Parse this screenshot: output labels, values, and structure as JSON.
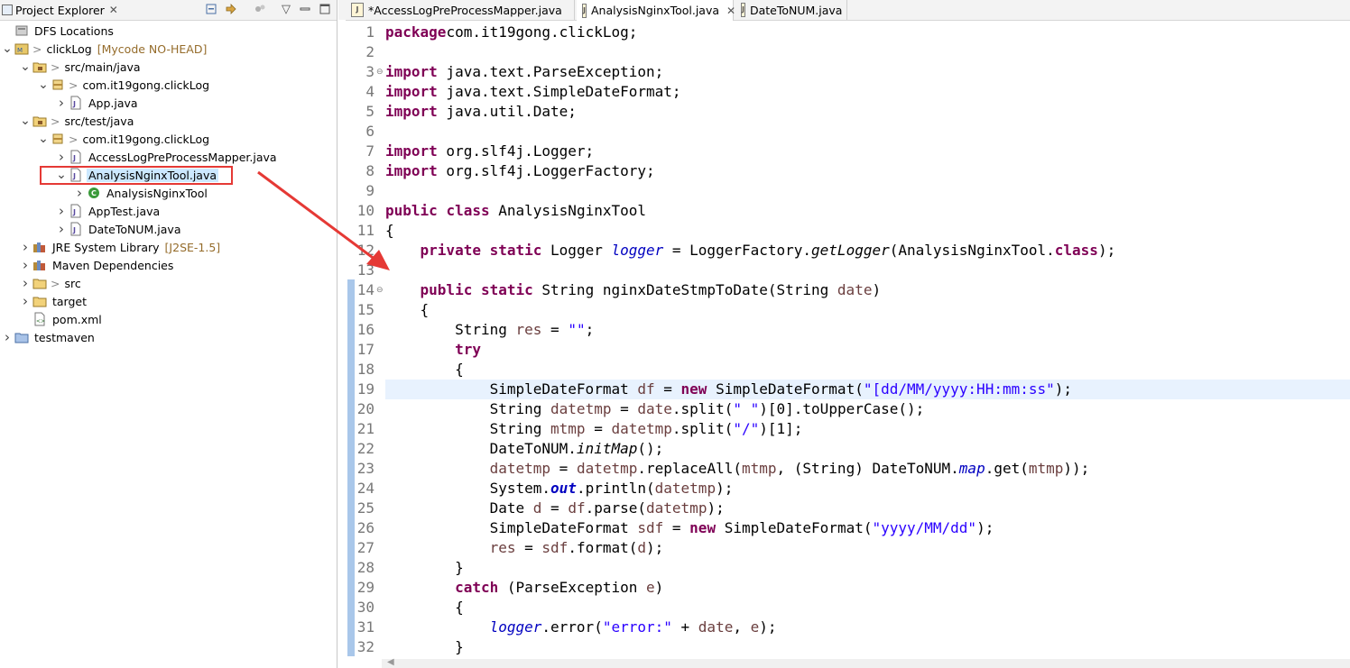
{
  "explorer": {
    "title": "Project Explorer",
    "tree": [
      {
        "indent": 0,
        "twisty": "",
        "icon": "dfs",
        "label": "DFS Locations"
      },
      {
        "indent": 0,
        "twisty": "v",
        "icon": "project",
        "label": "clickLog",
        "prefix": ">",
        "decoration": "[Mycode NO-HEAD]"
      },
      {
        "indent": 1,
        "twisty": "v",
        "icon": "srcfolder",
        "label": "src/main/java",
        "prefix": ">"
      },
      {
        "indent": 2,
        "twisty": "v",
        "icon": "package",
        "label": "com.it19gong.clickLog",
        "prefix": ">"
      },
      {
        "indent": 3,
        "twisty": ">",
        "icon": "java",
        "label": "App.java"
      },
      {
        "indent": 1,
        "twisty": "v",
        "icon": "srcfolder",
        "label": "src/test/java",
        "prefix": ">"
      },
      {
        "indent": 2,
        "twisty": "v",
        "icon": "package",
        "label": "com.it19gong.clickLog",
        "prefix": ">"
      },
      {
        "indent": 3,
        "twisty": ">",
        "icon": "java",
        "label": "AccessLogPreProcessMapper.java"
      },
      {
        "indent": 3,
        "twisty": "v",
        "icon": "java",
        "label": "AnalysisNginxTool.java",
        "selected": true
      },
      {
        "indent": 4,
        "twisty": ">",
        "icon": "class",
        "label": "AnalysisNginxTool"
      },
      {
        "indent": 3,
        "twisty": ">",
        "icon": "java",
        "label": "AppTest.java"
      },
      {
        "indent": 3,
        "twisty": ">",
        "icon": "java",
        "label": "DateToNUM.java"
      },
      {
        "indent": 1,
        "twisty": ">",
        "icon": "library",
        "label": "JRE System Library",
        "decoration": "[J2SE-1.5]"
      },
      {
        "indent": 1,
        "twisty": ">",
        "icon": "library",
        "label": "Maven Dependencies"
      },
      {
        "indent": 1,
        "twisty": ">",
        "icon": "folder",
        "label": "src",
        "prefix": ">"
      },
      {
        "indent": 1,
        "twisty": ">",
        "icon": "folder",
        "label": "target"
      },
      {
        "indent": 1,
        "twisty": "",
        "icon": "xml",
        "label": "pom.xml"
      },
      {
        "indent": 0,
        "twisty": ">",
        "icon": "project2",
        "label": "testmaven"
      }
    ]
  },
  "editor": {
    "tabs": [
      {
        "label": "*AccessLogPreProcessMapper.java",
        "active": false
      },
      {
        "label": "AnalysisNginxTool.java",
        "active": true
      },
      {
        "label": "DateToNUM.java",
        "active": false
      }
    ],
    "current_line": 19,
    "lines": [
      {
        "n": 1,
        "t": [
          [
            "kw",
            "package"
          ],
          [
            "",
            "com.it19gong.clickLog;"
          ]
        ]
      },
      {
        "n": 2,
        "t": []
      },
      {
        "n": 3,
        "fold": true,
        "t": [
          [
            "kw",
            "import"
          ],
          [
            "",
            " java.text.ParseException;"
          ]
        ]
      },
      {
        "n": 4,
        "t": [
          [
            "kw",
            "import"
          ],
          [
            "",
            " java.text.SimpleDateFormat;"
          ]
        ]
      },
      {
        "n": 5,
        "t": [
          [
            "kw",
            "import"
          ],
          [
            "",
            " java.util.Date;"
          ]
        ]
      },
      {
        "n": 6,
        "t": []
      },
      {
        "n": 7,
        "t": [
          [
            "kw",
            "import"
          ],
          [
            "",
            " org.slf4j.Logger;"
          ]
        ]
      },
      {
        "n": 8,
        "t": [
          [
            "kw",
            "import"
          ],
          [
            "",
            " org.slf4j.LoggerFactory;"
          ]
        ]
      },
      {
        "n": 9,
        "t": []
      },
      {
        "n": 10,
        "t": [
          [
            "kw",
            "public"
          ],
          [
            "",
            " "
          ],
          [
            "kw",
            "class"
          ],
          [
            "",
            " AnalysisNginxTool"
          ]
        ]
      },
      {
        "n": 11,
        "t": [
          [
            "",
            "{"
          ]
        ]
      },
      {
        "n": 12,
        "t": [
          [
            "",
            "    "
          ],
          [
            "kw",
            "private"
          ],
          [
            "",
            " "
          ],
          [
            "kw",
            "static"
          ],
          [
            "",
            " Logger "
          ],
          [
            "fld",
            "logger"
          ],
          [
            "",
            " = LoggerFactory."
          ],
          [
            "ital",
            "getLogger"
          ],
          [
            "",
            "(AnalysisNginxTool."
          ],
          [
            "kw",
            "class"
          ],
          [
            "",
            ");"
          ]
        ]
      },
      {
        "n": 13,
        "t": []
      },
      {
        "n": 14,
        "fold": true,
        "t": [
          [
            "",
            "    "
          ],
          [
            "kw",
            "public"
          ],
          [
            "",
            " "
          ],
          [
            "kw",
            "static"
          ],
          [
            "",
            " String nginxDateStmpToDate(String "
          ],
          [
            "var",
            "date"
          ],
          [
            "",
            ")"
          ]
        ]
      },
      {
        "n": 15,
        "t": [
          [
            "",
            "    {"
          ]
        ]
      },
      {
        "n": 16,
        "t": [
          [
            "",
            "        String "
          ],
          [
            "var",
            "res"
          ],
          [
            "",
            " = "
          ],
          [
            "str",
            "\"\""
          ],
          [
            "",
            ";"
          ]
        ]
      },
      {
        "n": 17,
        "t": [
          [
            "",
            "        "
          ],
          [
            "kw",
            "try"
          ]
        ]
      },
      {
        "n": 18,
        "t": [
          [
            "",
            "        {"
          ]
        ]
      },
      {
        "n": 19,
        "t": [
          [
            "",
            "            SimpleDateFormat "
          ],
          [
            "var",
            "df"
          ],
          [
            "",
            " = "
          ],
          [
            "kw",
            "new"
          ],
          [
            "",
            " SimpleDateFormat("
          ],
          [
            "str",
            "\"[dd/MM/yyyy:HH:mm:ss\""
          ],
          [
            "",
            ");"
          ]
        ]
      },
      {
        "n": 20,
        "t": [
          [
            "",
            "            String "
          ],
          [
            "var",
            "datetmp"
          ],
          [
            "",
            " = "
          ],
          [
            "var",
            "date"
          ],
          [
            "",
            ".split("
          ],
          [
            "str",
            "\" \""
          ],
          [
            "",
            ")[0].toUpperCase();"
          ]
        ]
      },
      {
        "n": 21,
        "t": [
          [
            "",
            "            String "
          ],
          [
            "var",
            "mtmp"
          ],
          [
            "",
            " = "
          ],
          [
            "var",
            "datetmp"
          ],
          [
            "",
            ".split("
          ],
          [
            "str",
            "\"/\""
          ],
          [
            "",
            ")[1];"
          ]
        ]
      },
      {
        "n": 22,
        "t": [
          [
            "",
            "            DateToNUM."
          ],
          [
            "ital",
            "initMap"
          ],
          [
            "",
            "();"
          ]
        ]
      },
      {
        "n": 23,
        "t": [
          [
            "",
            "            "
          ],
          [
            "var",
            "datetmp"
          ],
          [
            "",
            " = "
          ],
          [
            "var",
            "datetmp"
          ],
          [
            "",
            ".replaceAll("
          ],
          [
            "var",
            "mtmp"
          ],
          [
            "",
            ", (String) DateToNUM."
          ],
          [
            "fld",
            "map"
          ],
          [
            "",
            ".get("
          ],
          [
            "var",
            "mtmp"
          ],
          [
            "",
            "));"
          ]
        ]
      },
      {
        "n": 24,
        "t": [
          [
            "",
            "            System."
          ],
          [
            "fldb",
            "out"
          ],
          [
            "",
            ".println("
          ],
          [
            "var",
            "datetmp"
          ],
          [
            "",
            ");"
          ]
        ]
      },
      {
        "n": 25,
        "t": [
          [
            "",
            "            Date "
          ],
          [
            "var",
            "d"
          ],
          [
            "",
            " = "
          ],
          [
            "var",
            "df"
          ],
          [
            "",
            ".parse("
          ],
          [
            "var",
            "datetmp"
          ],
          [
            "",
            ");"
          ]
        ]
      },
      {
        "n": 26,
        "t": [
          [
            "",
            "            SimpleDateFormat "
          ],
          [
            "var",
            "sdf"
          ],
          [
            "",
            " = "
          ],
          [
            "kw",
            "new"
          ],
          [
            "",
            " SimpleDateFormat("
          ],
          [
            "str",
            "\"yyyy/MM/dd\""
          ],
          [
            "",
            ");"
          ]
        ]
      },
      {
        "n": 27,
        "t": [
          [
            "",
            "            "
          ],
          [
            "var",
            "res"
          ],
          [
            "",
            " = "
          ],
          [
            "var",
            "sdf"
          ],
          [
            "",
            ".format("
          ],
          [
            "var",
            "d"
          ],
          [
            "",
            ");"
          ]
        ]
      },
      {
        "n": 28,
        "t": [
          [
            "",
            "        }"
          ]
        ]
      },
      {
        "n": 29,
        "t": [
          [
            "",
            "        "
          ],
          [
            "kw",
            "catch"
          ],
          [
            "",
            " (ParseException "
          ],
          [
            "var",
            "e"
          ],
          [
            "",
            ")"
          ]
        ]
      },
      {
        "n": 30,
        "t": [
          [
            "",
            "        {"
          ]
        ]
      },
      {
        "n": 31,
        "t": [
          [
            "",
            "            "
          ],
          [
            "fld",
            "logger"
          ],
          [
            "",
            ".error("
          ],
          [
            "str",
            "\"error:\""
          ],
          [
            "",
            " + "
          ],
          [
            "var",
            "date"
          ],
          [
            "",
            ", "
          ],
          [
            "var",
            "e"
          ],
          [
            "",
            ");"
          ]
        ]
      },
      {
        "n": 32,
        "t": [
          [
            "",
            "        }"
          ]
        ]
      }
    ]
  },
  "colors": {
    "keyword": "#7f0055",
    "string": "#2a00ff",
    "field": "#0000c0",
    "local": "#6a3e3e",
    "annotation": "#e53935"
  }
}
